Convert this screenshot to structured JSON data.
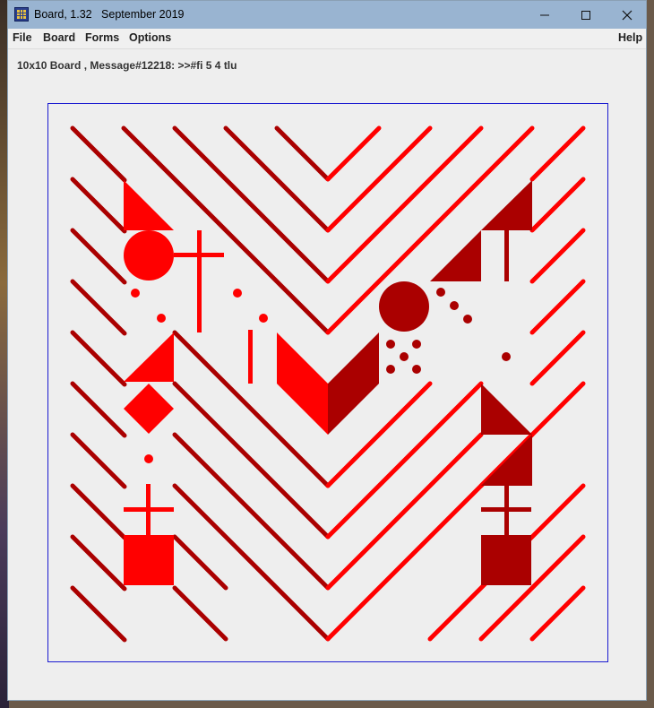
{
  "window": {
    "title": "Board, 1.32   September 2019",
    "minimize_icon": "minimize-icon",
    "maximize_icon": "maximize-icon",
    "close_icon": "close-icon"
  },
  "menu": {
    "file": "File",
    "board": "Board",
    "forms": "Forms",
    "options": "Options",
    "help": "Help"
  },
  "status": {
    "message": "10x10 Board , Message#12218: >>#fi 5 4 tlu"
  },
  "board": {
    "size": "10x10",
    "colors": {
      "red": "#ff0000",
      "dark_red": "#aa0000",
      "frame": "#1a1ad0"
    }
  }
}
